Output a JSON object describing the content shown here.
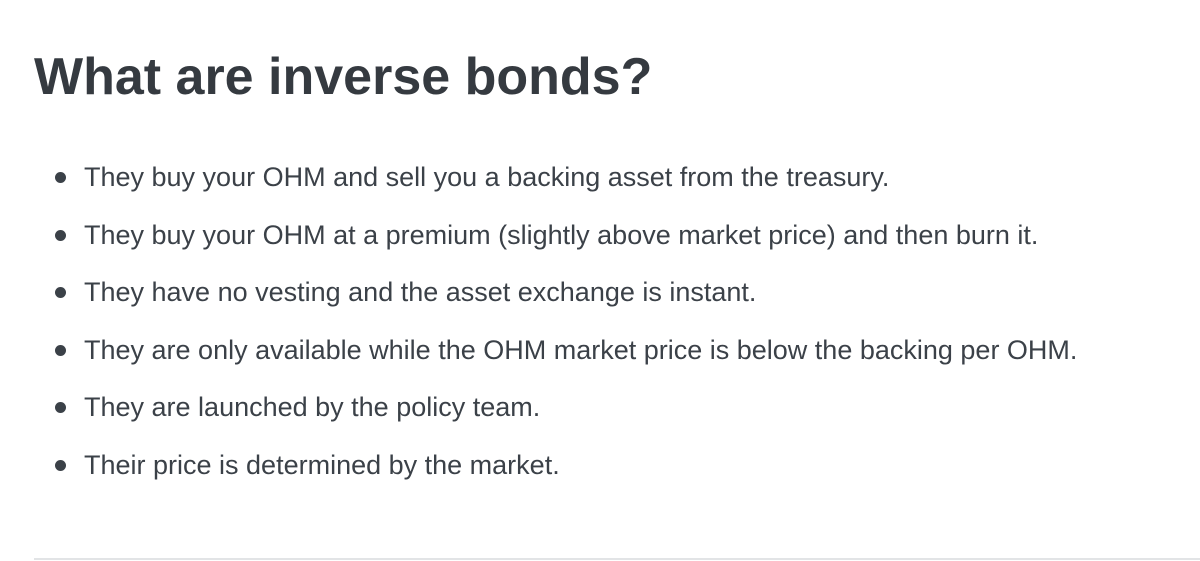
{
  "page": {
    "heading": "What are inverse bonds?",
    "bullets": [
      "They buy your OHM and sell you a backing asset from the treasury.",
      "They buy your OHM at a premium (slightly above market price) and then burn it.",
      "They have no vesting and the asset exchange is instant.",
      "They are only available while the OHM market price is below the backing per OHM.",
      "They are launched by the policy team.",
      "Their price is determined by the market."
    ]
  }
}
